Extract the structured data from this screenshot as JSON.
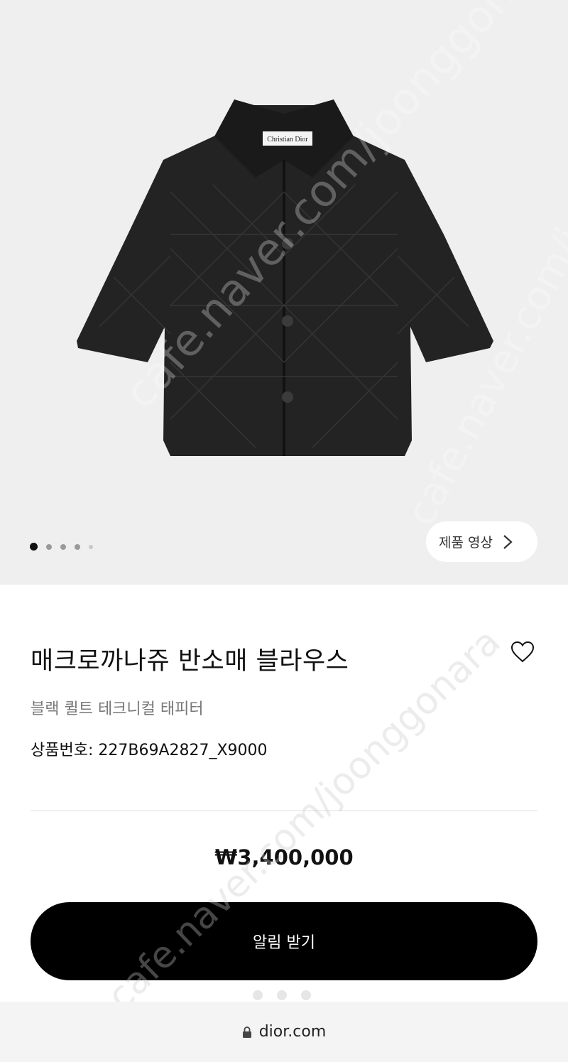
{
  "gallery": {
    "video_button_label": "제품 영상",
    "slide_count": 5,
    "active_slide": 1
  },
  "product": {
    "name": "매크로까나쥬 반소매 블라우스",
    "subtitle": "블랙 퀼트 테크니컬 태피터",
    "code": "상품번호: 227B69A2827_X9000",
    "price": "₩3,400,000",
    "label_brand": "Christian Dior"
  },
  "actions": {
    "notify_label": "알림 받기"
  },
  "browser": {
    "url": "dior.com"
  },
  "watermark": {
    "text1": "cafe.naver.com/joonggonara",
    "text2": "cafe.naver.com/joonggonara",
    "text3": "cafe.naver.com/joonggonara"
  },
  "colors": {
    "hero_bg": "#efefef",
    "cta_bg": "#000000",
    "jacket": "#242323"
  }
}
